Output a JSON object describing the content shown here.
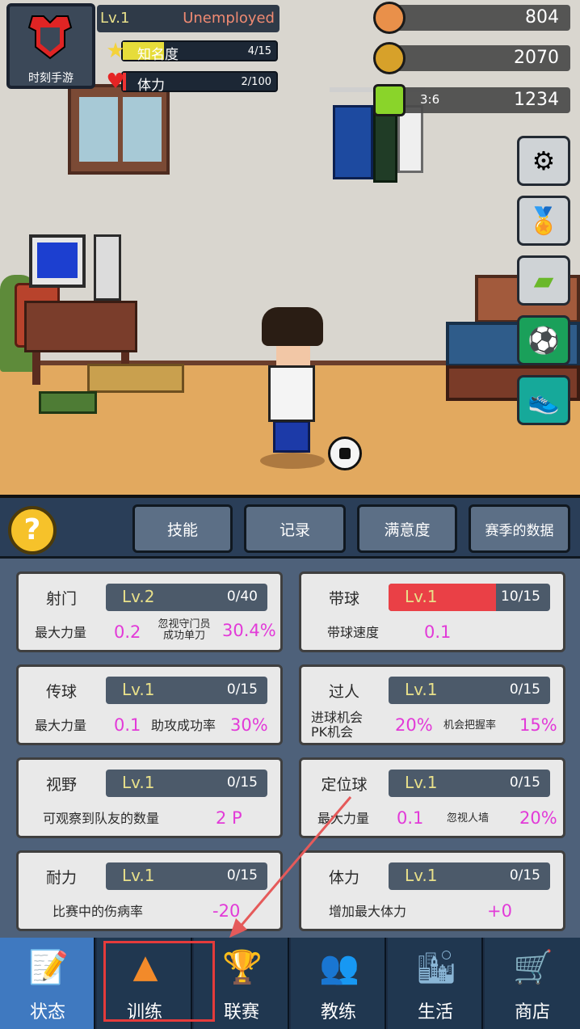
{
  "profile": {
    "logo_text": "时刻手游"
  },
  "player_info": {
    "level": "Lv.1",
    "job": "Unemployed"
  },
  "fame": {
    "label": "知名度",
    "value": "4/15",
    "fill": 0.27
  },
  "stamina": {
    "label": "体力",
    "value": "2/100",
    "fill": 0.02
  },
  "currencies": {
    "coins": "804",
    "gems": "2070",
    "tickets": "1234",
    "ticket_timer": "3:6"
  },
  "panel_tabs": [
    "技能",
    "记录",
    "满意度",
    "赛季的数据"
  ],
  "help": {
    "label": "?"
  },
  "skills": [
    {
      "name": "射门",
      "level": "Lv.2",
      "progress": "0/40",
      "fill": 0,
      "stat1_label": "最大力量",
      "stat1_value": "0.2",
      "stat2_label": "忽视守门员\n成功单刀",
      "stat2_value": "30.4%"
    },
    {
      "name": "带球",
      "level": "Lv.1",
      "progress": "10/15",
      "fill": 0.667,
      "stat1_label": "带球速度",
      "stat1_value": "0.1"
    },
    {
      "name": "传球",
      "level": "Lv.1",
      "progress": "0/15",
      "fill": 0,
      "stat1_label": "最大力量",
      "stat1_value": "0.1",
      "stat2_label": "助攻成功率",
      "stat2_value": "30%"
    },
    {
      "name": "过人",
      "level": "Lv.1",
      "progress": "0/15",
      "fill": 0,
      "stat1_label": "进球机会\nPK机会",
      "stat1_value": "20%",
      "stat2_label": "机会把握率",
      "stat2_value": "15%"
    },
    {
      "name": "视野",
      "level": "Lv.1",
      "progress": "0/15",
      "fill": 0,
      "stat1_label": "可观察到队友的数量",
      "stat1_value": "2 P"
    },
    {
      "name": "定位球",
      "level": "Lv.1",
      "progress": "0/15",
      "fill": 0,
      "stat1_label": "最大力量",
      "stat1_value": "0.1",
      "stat2_label": "忽视人墙",
      "stat2_value": "20%"
    },
    {
      "name": "耐力",
      "level": "Lv.1",
      "progress": "0/15",
      "fill": 0,
      "stat1_label": "比赛中的伤病率",
      "stat1_value": "-20"
    },
    {
      "name": "体力",
      "level": "Lv.1",
      "progress": "0/15",
      "fill": 0,
      "stat1_label": "增加最大体力",
      "stat1_value": "+0"
    }
  ],
  "nav": [
    {
      "label": "状态",
      "icon": "notepad-icon",
      "active": true
    },
    {
      "label": "训练",
      "icon": "cones-icon",
      "active": false
    },
    {
      "label": "联赛",
      "icon": "trophy-ball-icon",
      "active": false
    },
    {
      "label": "教练",
      "icon": "coaches-icon",
      "active": false
    },
    {
      "label": "生活",
      "icon": "city-icon",
      "active": false
    },
    {
      "label": "商店",
      "icon": "shopping-cart-icon",
      "active": false
    }
  ],
  "colors": {
    "accent_magenta": "#e23ad8",
    "annotation_red": "#e53b3b",
    "panel_blue": "#2a3e58",
    "active_tab": "#3f79c0"
  }
}
